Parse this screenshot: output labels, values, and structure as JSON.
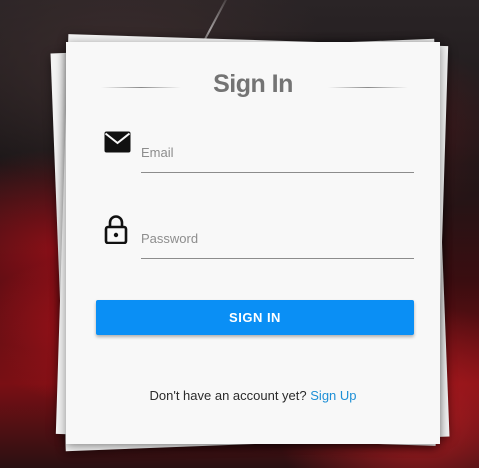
{
  "form": {
    "title": "Sign In",
    "email": {
      "placeholder": "Email",
      "value": ""
    },
    "password": {
      "placeholder": "Password",
      "value": ""
    },
    "submit_label": "SIGN IN",
    "footer_text": "Don't have an account yet?",
    "signup_link": "Sign Up"
  },
  "colors": {
    "accent": "#0a8ff5",
    "link": "#1d8fd6",
    "title": "#747474",
    "card": "#f8f8f8"
  },
  "icons": {
    "email": "envelope-icon",
    "password": "padlock-icon"
  }
}
